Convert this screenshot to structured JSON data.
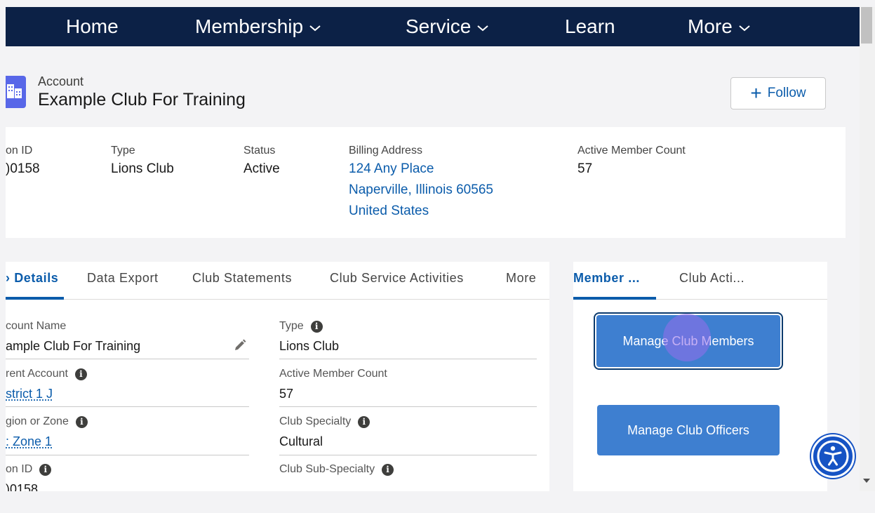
{
  "nav": {
    "items": [
      {
        "label": "Home",
        "dropdown": false
      },
      {
        "label": "Membership",
        "dropdown": true
      },
      {
        "label": "Service",
        "dropdown": true
      },
      {
        "label": "Learn",
        "dropdown": false
      },
      {
        "label": "More",
        "dropdown": true
      }
    ]
  },
  "header": {
    "object_label": "Account",
    "title": "Example Club For Training",
    "follow_label": "Follow"
  },
  "highlights": {
    "fields": [
      {
        "label": "on ID",
        "value": ")0158"
      },
      {
        "label": "Type",
        "value": "Lions Club"
      },
      {
        "label": "Status",
        "value": "Active"
      },
      {
        "label": "Billing Address",
        "lines": [
          "124 Any Place",
          "Naperville, Illinois 60565",
          "United States"
        ]
      },
      {
        "label": "Active Member Count",
        "value": "57"
      }
    ]
  },
  "left_tabs": [
    "› Details",
    "Data Export",
    "Club Statements",
    "Club Service Activities",
    "More"
  ],
  "details": {
    "left": [
      {
        "label": "count Name",
        "value": "ample Club For Training",
        "link": false,
        "info": false
      },
      {
        "label": "rent Account",
        "value": "strict 1 J",
        "link": true,
        "info": true
      },
      {
        "label": "gion or Zone",
        "value": ": Zone 1",
        "link": true,
        "info": true
      },
      {
        "label": "on ID",
        "value": ")0158",
        "link": false,
        "info": true
      }
    ],
    "right": [
      {
        "label": "Type",
        "value": "Lions Club",
        "info": true
      },
      {
        "label": "Active Member Count",
        "value": "57",
        "info": false
      },
      {
        "label": "Club Specialty",
        "value": "Cultural",
        "info": true
      },
      {
        "label": "Club Sub-Specialty",
        "value": "",
        "info": true
      }
    ]
  },
  "right_tabs": [
    "Member ...",
    "Club Acti..."
  ],
  "actions": {
    "manage_members": "Manage Club Members",
    "manage_officers": "Manage Club Officers"
  },
  "icons": {
    "account": "building-icon",
    "follow": "plus-icon",
    "edit": "pencil-icon",
    "info": "info-icon",
    "accessibility": "accessibility-icon"
  },
  "colors": {
    "nav_bg": "#0c2146",
    "link": "#0b5cab",
    "button": "#3e7fd0",
    "account_icon": "#5867e8",
    "accessibility": "#1653c4"
  }
}
